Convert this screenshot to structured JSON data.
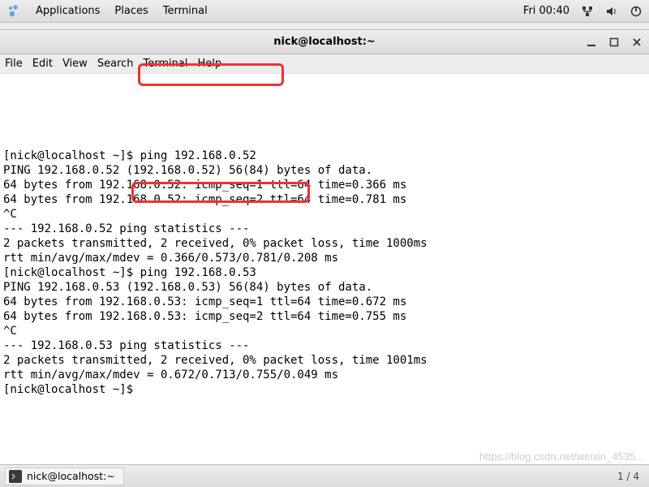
{
  "topbar": {
    "apps": "Applications",
    "places": "Places",
    "terminal": "Terminal",
    "clock": "Fri 00:40"
  },
  "window": {
    "title": "nick@localhost:~"
  },
  "menubar": {
    "file": "File",
    "edit": "Edit",
    "view": "View",
    "search": "Search",
    "terminal": "Terminal",
    "help": "Help"
  },
  "terminal": {
    "lines": [
      "[nick@localhost ~]$ ping 192.168.0.52",
      "PING 192.168.0.52 (192.168.0.52) 56(84) bytes of data.",
      "64 bytes from 192.168.0.52: icmp_seq=1 ttl=64 time=0.366 ms",
      "64 bytes from 192.168.0.52: icmp_seq=2 ttl=64 time=0.781 ms",
      "^C",
      "--- 192.168.0.52 ping statistics ---",
      "2 packets transmitted, 2 received, 0% packet loss, time 1000ms",
      "rtt min/avg/max/mdev = 0.366/0.573/0.781/0.208 ms",
      "[nick@localhost ~]$ ping 192.168.0.53",
      "PING 192.168.0.53 (192.168.0.53) 56(84) bytes of data.",
      "64 bytes from 192.168.0.53: icmp_seq=1 ttl=64 time=0.672 ms",
      "64 bytes from 192.168.0.53: icmp_seq=2 ttl=64 time=0.755 ms",
      "^C",
      "--- 192.168.0.53 ping statistics ---",
      "2 packets transmitted, 2 received, 0% packet loss, time 1001ms",
      "rtt min/avg/max/mdev = 0.672/0.713/0.755/0.049 ms",
      "[nick@localhost ~]$ "
    ]
  },
  "taskbar": {
    "task_label": "nick@localhost:~",
    "pager": "1 / 4"
  },
  "watermark": "https://blog.csdn.net/weixin_4535..."
}
